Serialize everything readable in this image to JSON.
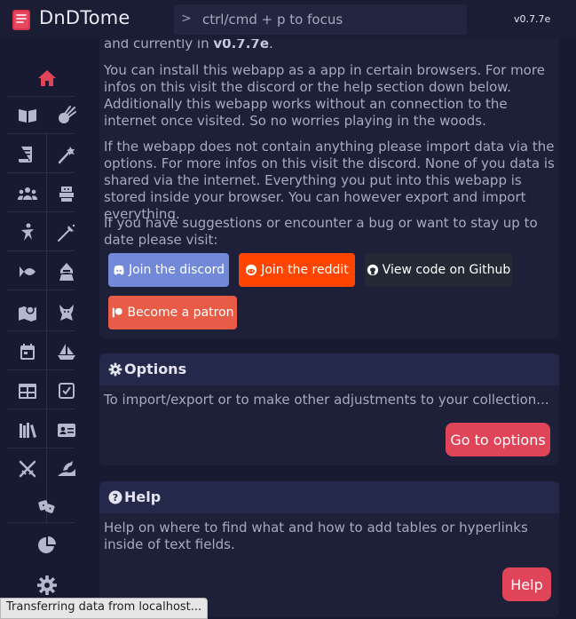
{
  "app": {
    "title": "DnDTome",
    "version": "v0.7.7e"
  },
  "search": {
    "prompt": ">",
    "placeholder": "ctrl/cmd + p to focus"
  },
  "sidebar": {
    "icons": [
      "home-icon",
      "book-icon",
      "meteor-icon",
      "scroll-icon",
      "wand-icon",
      "group-icon",
      "monster-icon",
      "class-icon",
      "feat-icon",
      "fish-icon",
      "assassin-icon",
      "map-icon",
      "demon-icon",
      "calendar-icon",
      "boat-icon",
      "table-icon",
      "checklist-icon",
      "bookshelf-icon",
      "id-card-icon",
      "swords-icon",
      "dragon-icon",
      "dice-icon",
      "chart-icon",
      "settings-icon"
    ]
  },
  "intro": {
    "top_line_prefix": "and currently in ",
    "top_line_version": "v0.7.7e",
    "top_line_suffix": ".",
    "para1": "You can install this webapp as a app in certain browsers. For more infos on this visit the discord or the help section down below. Additionally this webapp works without an connection to the internet once visited. So no worries playing in the woods.",
    "para2": "If the webapp does not contain anything please import data via the options. For more infos on this visit the discord. None of you data is shared via the internet. Everything you put into this webapp is stored inside your browser. You can however export and import everything.",
    "para3": "If you have suggestions or encounter a bug or want to stay up to date please visit:",
    "buttons": {
      "discord": "Join the discord",
      "reddit": "Join the reddit",
      "github": "View code on Github",
      "patron": "Become a patron"
    }
  },
  "options_card": {
    "title": "Options",
    "text": "To import/export or to make other adjustments to your collection...",
    "button": "Go to options"
  },
  "help_card": {
    "title": "Help",
    "text": "Help on where to find what and how to add tables or hyperlinks inside of text fields.",
    "button": "Help"
  },
  "status": {
    "text": "Transferring data from localhost..."
  },
  "colors": {
    "accent": "#e04458",
    "discord": "#7289da",
    "reddit": "#ff4500",
    "github": "#24292e",
    "patron": "#e85b46",
    "background": "#171a30",
    "card": "#1d2038"
  }
}
